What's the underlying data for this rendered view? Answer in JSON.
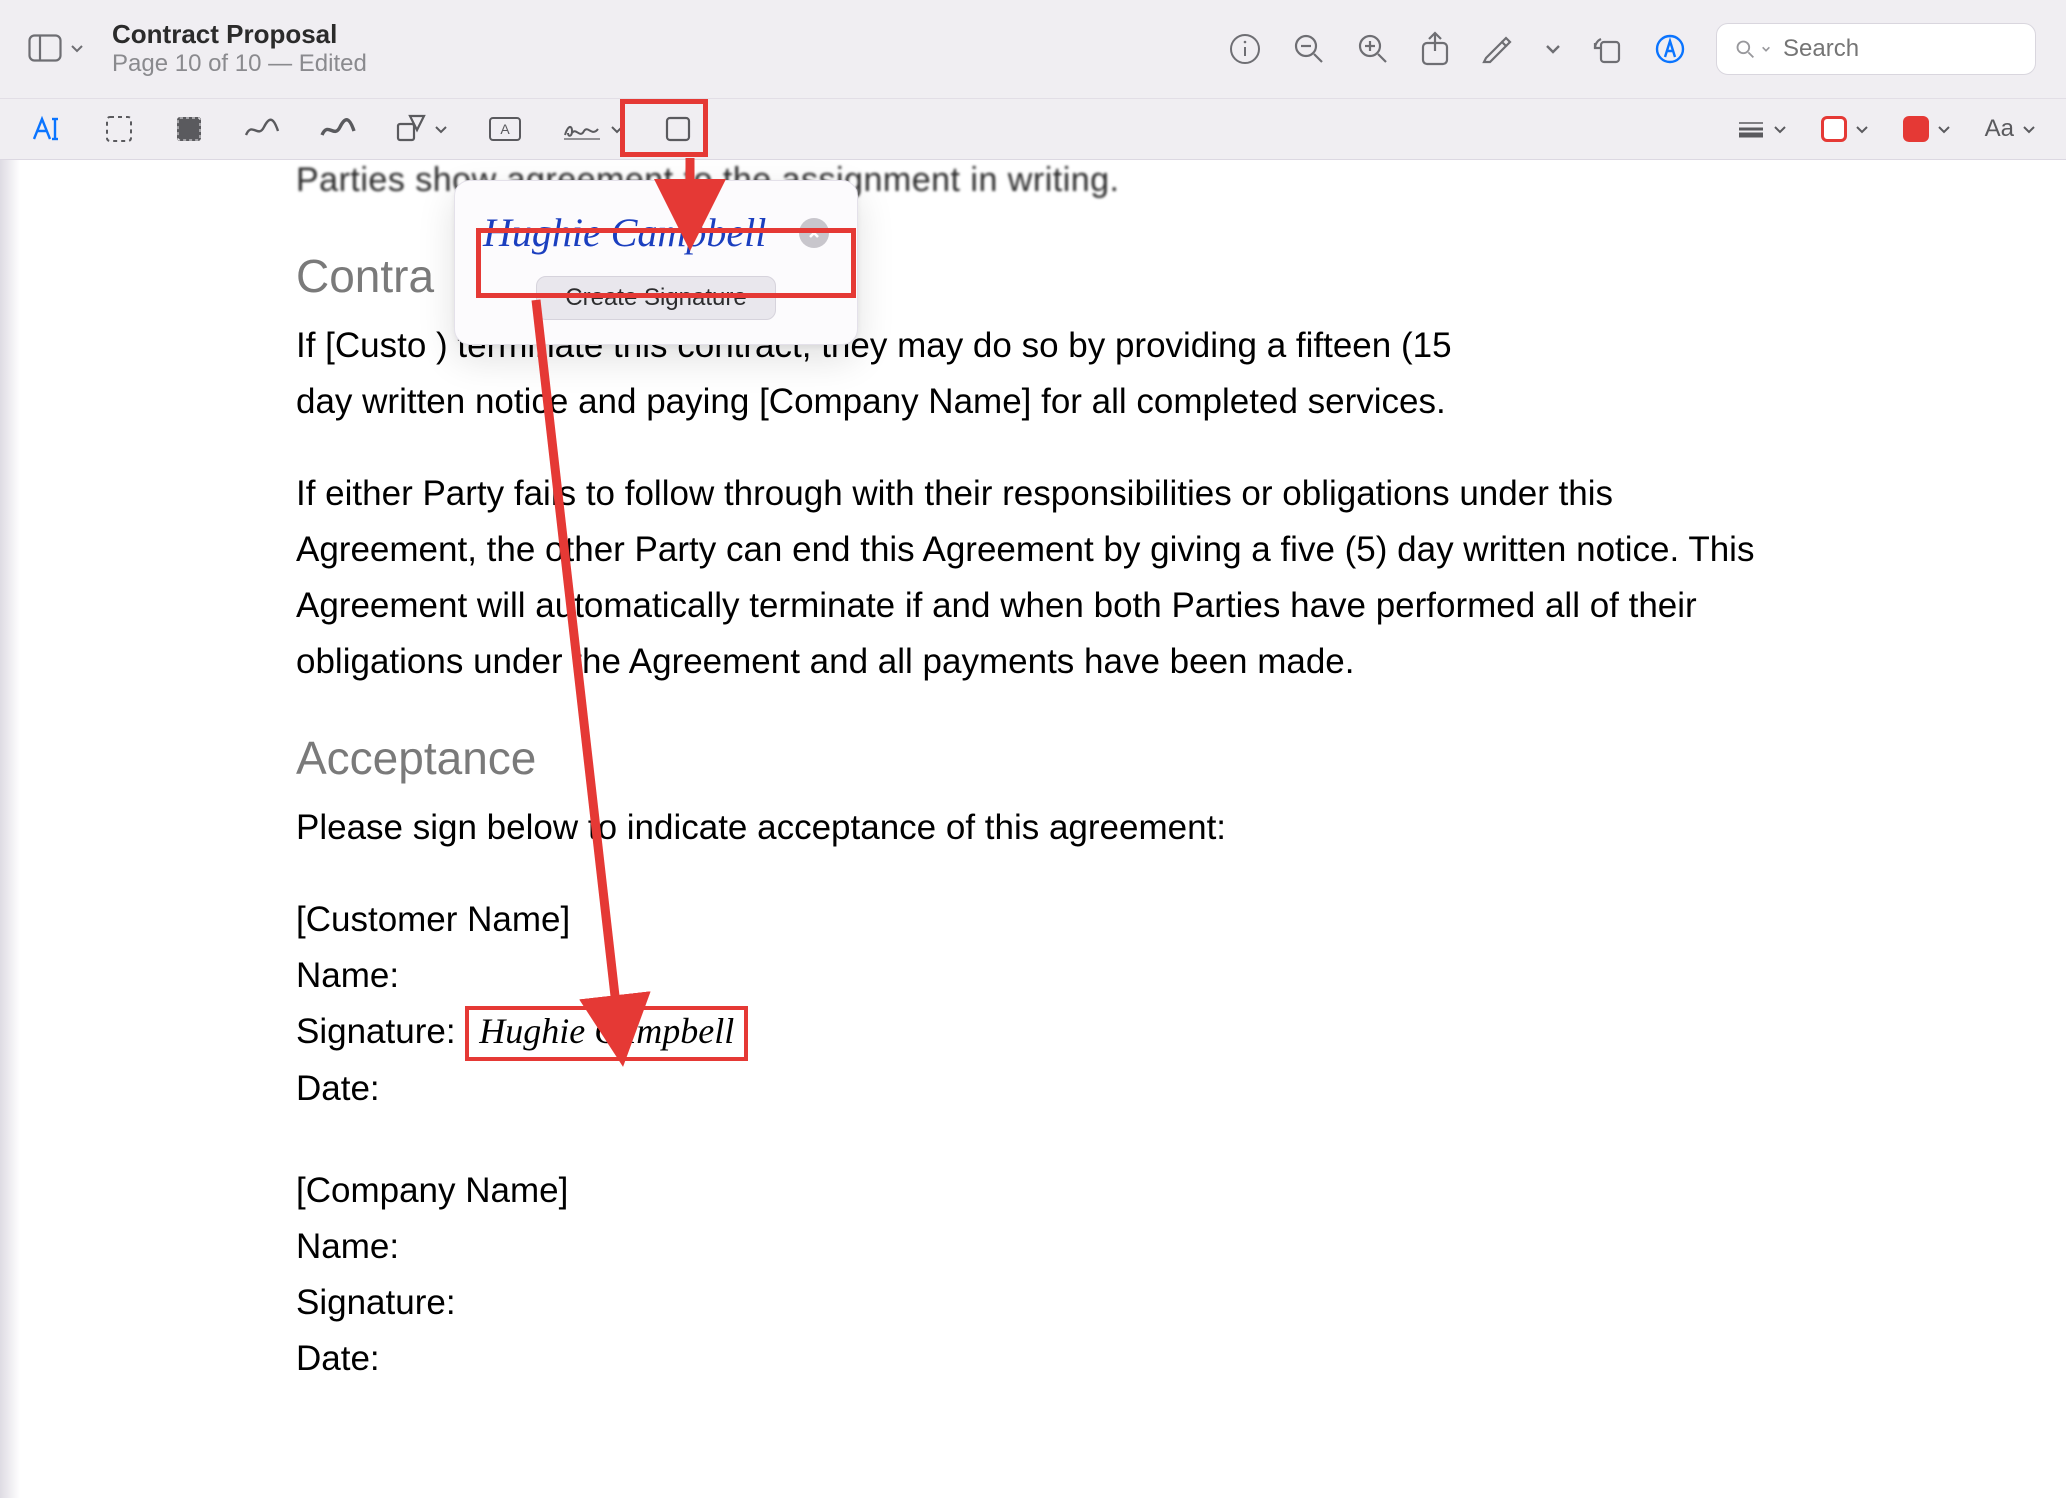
{
  "titlebar": {
    "doc_title": "Contract Proposal",
    "doc_subtitle": "Page 10 of 10 — Edited",
    "search_placeholder": "Search"
  },
  "markupbar": {
    "aa_label": "Aa"
  },
  "signature_popover": {
    "saved_signature": "Hughie Campbell",
    "create_label": "Create Signature"
  },
  "document": {
    "blurred_top": "Parties show agreement to the assignment in writing.",
    "h_contract_term": "Contra",
    "p1": "If [Custo                                                       ) terminate this contract, they may do so by providing a fifteen (15",
    "p1b": "day written notice and paying [Company Name] for all completed services.",
    "p2a": "If either Party fails to follow through with their responsibilities or obligations under this",
    "p2b": "Agreement, the other Party can end this Agreement by giving a five (5) day written notice. This",
    "p2c": "Agreement will automatically terminate if and when both Parties have performed all of their",
    "p2d": "obligations under the Agreement and all payments have been made.",
    "h_acceptance": "Acceptance",
    "p3": "Please sign below to indicate acceptance of this agreement:",
    "customer_block": {
      "title": "[Customer Name]",
      "name_label": "Name:",
      "signature_label": "Signature:",
      "signed_name": "Hughie Campbell",
      "date_label": "Date:"
    },
    "company_block": {
      "title": "[Company Name]",
      "name_label": "Name:",
      "signature_label": "Signature:",
      "date_label": "Date:"
    }
  },
  "colors": {
    "annotation": "#e53935",
    "accent": "#0a74ff"
  }
}
